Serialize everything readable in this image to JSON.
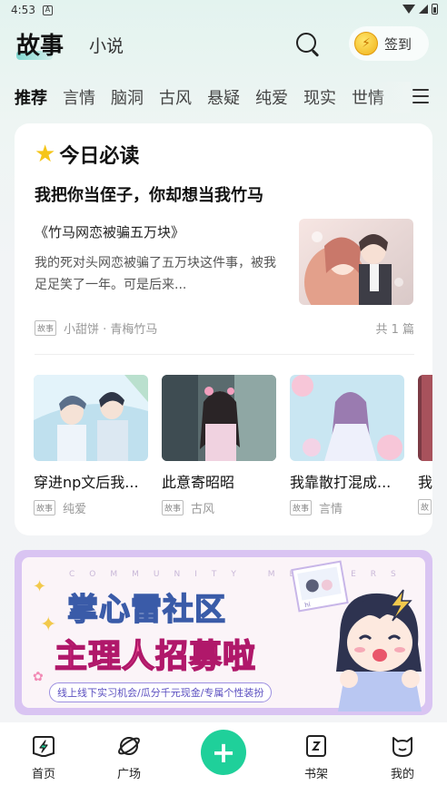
{
  "status_bar": {
    "time": "4:53",
    "notif_icon": "A"
  },
  "header": {
    "tab_active": "故事",
    "tab_inactive": "小说",
    "signin_label": "签到"
  },
  "categories": [
    "推荐",
    "言情",
    "脑洞",
    "古风",
    "悬疑",
    "纯爱",
    "现实",
    "世情"
  ],
  "featured": {
    "section_title": "今日必读",
    "headline": "我把你当侄子，你却想当我竹马",
    "subtitle": "《竹马网恋被骗五万块》",
    "excerpt": "我的死对头网恋被骗了五万块这件事，被我足足笑了一年。可是后来...",
    "tag": "故事",
    "meta": "小甜饼 · 青梅竹马",
    "count": "共 1 篇"
  },
  "books": [
    {
      "title": "穿进np文后我...",
      "tag": "故事",
      "genre": "纯爱"
    },
    {
      "title": "此意寄昭昭",
      "tag": "故事",
      "genre": "古风"
    },
    {
      "title": "我靠散打混成...",
      "tag": "故事",
      "genre": "言情"
    },
    {
      "title": "我",
      "tag": "故",
      "genre": ""
    }
  ],
  "banner": {
    "community_text": "COMMUNITY MEMBERS",
    "line1": "掌心雷社区",
    "line2": "主理人招募啦",
    "tagline": "线上线下实习机会/瓜分千元现金/专属个性装扮",
    "photo_text": "hi"
  },
  "bottom_nav": {
    "home": "首页",
    "square": "广场",
    "shelf": "书架",
    "mine": "我的",
    "add_symbol": "+"
  },
  "colors": {
    "accent_green": "#1fd09a",
    "star": "#f5c518",
    "coin": "#f0b21a"
  }
}
